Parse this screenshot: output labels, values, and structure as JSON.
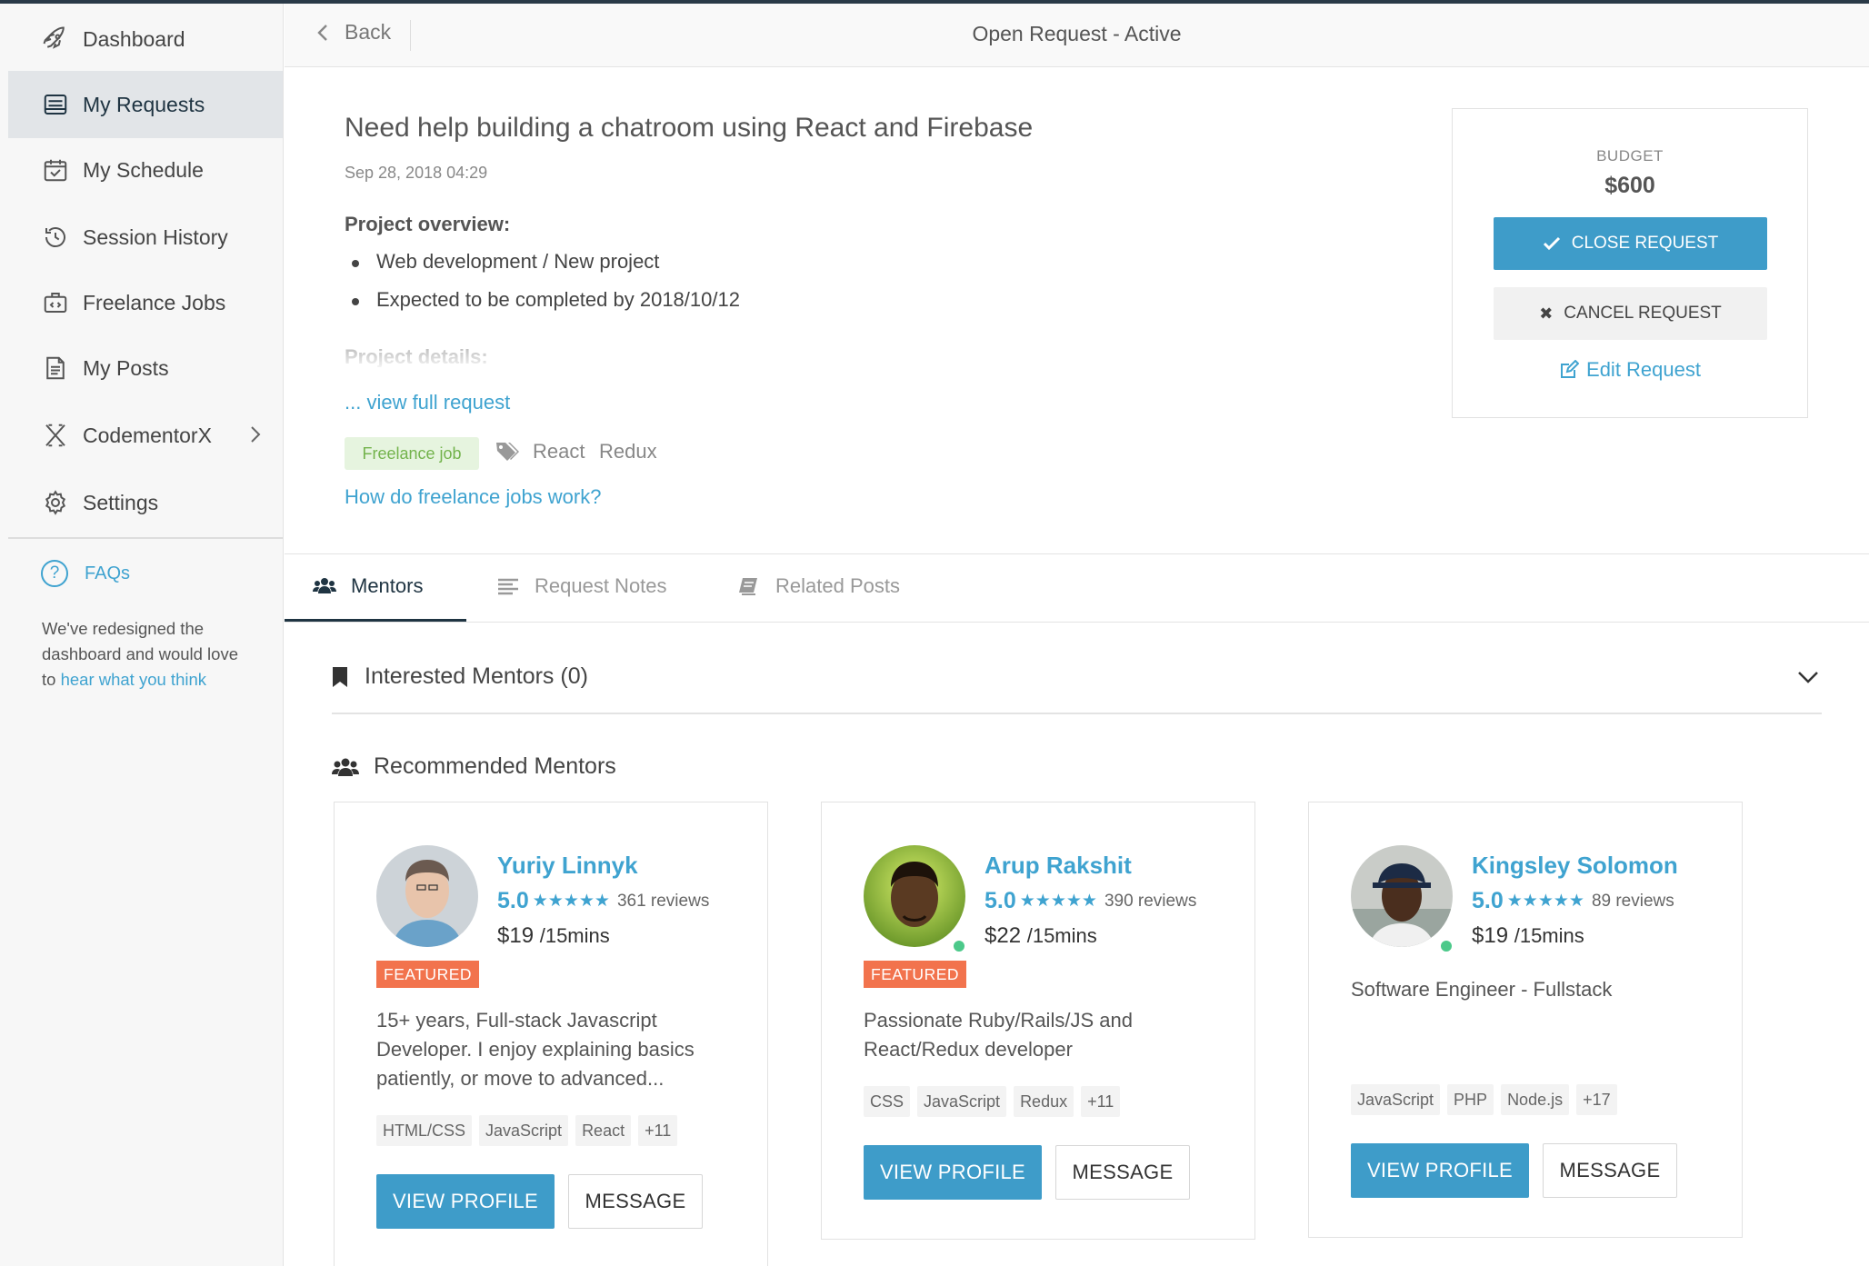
{
  "sidebar": {
    "items": [
      {
        "label": "Dashboard",
        "icon": "rocket-icon"
      },
      {
        "label": "My Requests",
        "icon": "requests-icon",
        "active": true
      },
      {
        "label": "My Schedule",
        "icon": "calendar-icon"
      },
      {
        "label": "Session History",
        "icon": "history-icon"
      },
      {
        "label": "Freelance Jobs",
        "icon": "briefcase-icon"
      },
      {
        "label": "My Posts",
        "icon": "document-icon"
      },
      {
        "label": "CodementorX",
        "icon": "x-logo-icon"
      },
      {
        "label": "Settings",
        "icon": "gear-icon"
      }
    ],
    "faq_label": "FAQs",
    "feedback_text": "We've redesigned the dashboard and would love to ",
    "feedback_link": "hear what you think"
  },
  "header": {
    "back_label": "Back",
    "title": "Open Request - Active"
  },
  "request": {
    "title": "Need help building a chatroom using React and Firebase",
    "date": "Sep 28, 2018 04:29",
    "overview_title": "Project overview:",
    "overview_items": [
      "Web development / New project",
      "Expected to be completed by 2018/10/12"
    ],
    "details_title": "Project details:",
    "view_full": "... view full request",
    "type_tag": "Freelance job",
    "keywords": [
      "React",
      "Redux"
    ],
    "how_link": "How do freelance jobs work?"
  },
  "budget": {
    "label": "BUDGET",
    "amount": "$600",
    "close_label": "CLOSE REQUEST",
    "cancel_label": "CANCEL REQUEST",
    "edit_label": "Edit Request"
  },
  "tabs": [
    {
      "label": "Mentors",
      "active": true
    },
    {
      "label": "Request Notes"
    },
    {
      "label": "Related Posts"
    }
  ],
  "interested": {
    "title": "Interested Mentors (0)"
  },
  "recommended": {
    "title": "Recommended Mentors"
  },
  "mentors": [
    {
      "name": "Yuriy Linnyk",
      "score": "5.0",
      "stars": "★★★★★",
      "reviews": "361 reviews",
      "price": "$19",
      "per": "/15mins",
      "featured": "FEATURED",
      "description": "15+ years, Full-stack Javascript Developer. I enjoy explaining basics patiently, or move to advanced...",
      "skills": [
        "HTML/CSS",
        "JavaScript",
        "React",
        "+11"
      ],
      "view_label": "VIEW PROFILE",
      "message_label": "MESSAGE"
    },
    {
      "name": "Arup Rakshit",
      "score": "5.0",
      "stars": "★★★★★",
      "reviews": "390 reviews",
      "price": "$22",
      "per": "/15mins",
      "featured": "FEATURED",
      "description": "Passionate Ruby/Rails/JS and React/Redux developer",
      "skills": [
        "CSS",
        "JavaScript",
        "Redux",
        "+11"
      ],
      "view_label": "VIEW PROFILE",
      "message_label": "MESSAGE"
    },
    {
      "name": "Kingsley Solomon",
      "score": "5.0",
      "stars": "★★★★★",
      "reviews": "89 reviews",
      "price": "$19",
      "per": "/15mins",
      "description": "Software Engineer - Fullstack",
      "skills": [
        "JavaScript",
        "PHP",
        "Node.js",
        "+17"
      ],
      "view_label": "VIEW PROFILE",
      "message_label": "MESSAGE"
    }
  ],
  "colors": {
    "accent": "#3e9cc9",
    "link": "#3fa3d0",
    "featured": "#f2734d",
    "online": "#4cc98a",
    "active_nav": "#1f3442"
  }
}
